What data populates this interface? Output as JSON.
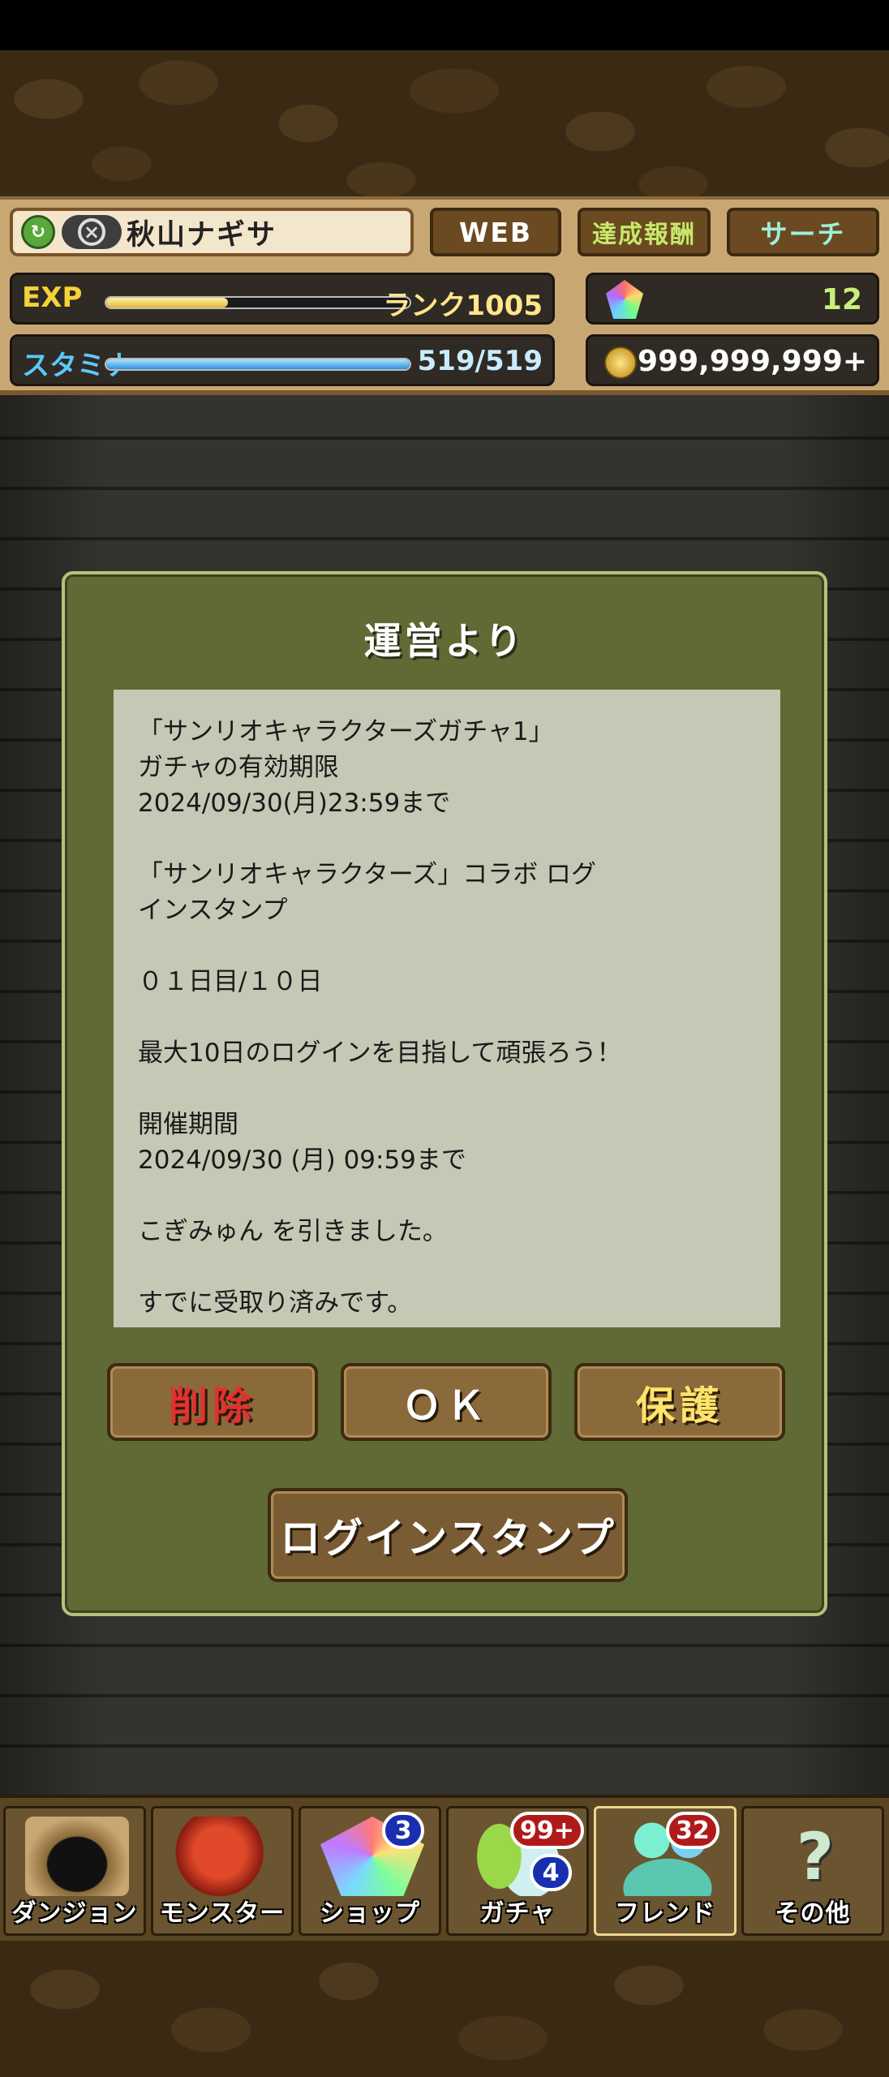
{
  "header": {
    "player_name": "秋山ナギサ",
    "web_label": "WEB",
    "reward_label": "達成報酬",
    "search_label": "サーチ"
  },
  "stats": {
    "exp_label": "EXP",
    "exp_progress": 0.4,
    "rank_text": "ランク1005",
    "stamina_label": "スタミナ",
    "stamina_progress": 1.0,
    "stamina_text": "519/519",
    "magic_stones": "12",
    "coins": "999,999,999+"
  },
  "dialog": {
    "title": "運営より",
    "lines": [
      "「サンリオキャラクターズガチャ1」",
      "ガチャの有効期限",
      "2024/09/30(月)23:59まで",
      "",
      "「サンリオキャラクターズ」コラボ ログ",
      "インスタンプ",
      "",
      "０１日目/１０日",
      "",
      "最大10日のログインを目指して頑張ろう！",
      "",
      "開催期間",
      "2024/09/30 (月) 09:59まで",
      "",
      "こぎみゅん を引きました。",
      "",
      "すでに受取り済みです。"
    ],
    "delete_label": "削除",
    "ok_label": "ＯＫ",
    "protect_label": "保護",
    "stamp_label": "ログインスタンプ"
  },
  "nav": {
    "items": [
      {
        "label": "ダンジョン",
        "icon": "dungeon-gate-icon"
      },
      {
        "label": "モンスター",
        "icon": "dragon-icon"
      },
      {
        "label": "ショップ",
        "icon": "rainbow-gem-icon",
        "badge": "3"
      },
      {
        "label": "ガチャ",
        "icon": "egg-icon",
        "badge_top": "99+",
        "badge_bottom": "4"
      },
      {
        "label": "フレンド",
        "icon": "friends-icon",
        "badge": "32"
      },
      {
        "label": "その他",
        "icon": "question-mark-icon"
      }
    ]
  },
  "colors": {
    "dialog_bg": "#5f6a35",
    "message_bg": "#c5c8b4",
    "delete_text": "#e23030",
    "protect_text": "#ffe36b",
    "hud_bg": "#c9a773"
  }
}
